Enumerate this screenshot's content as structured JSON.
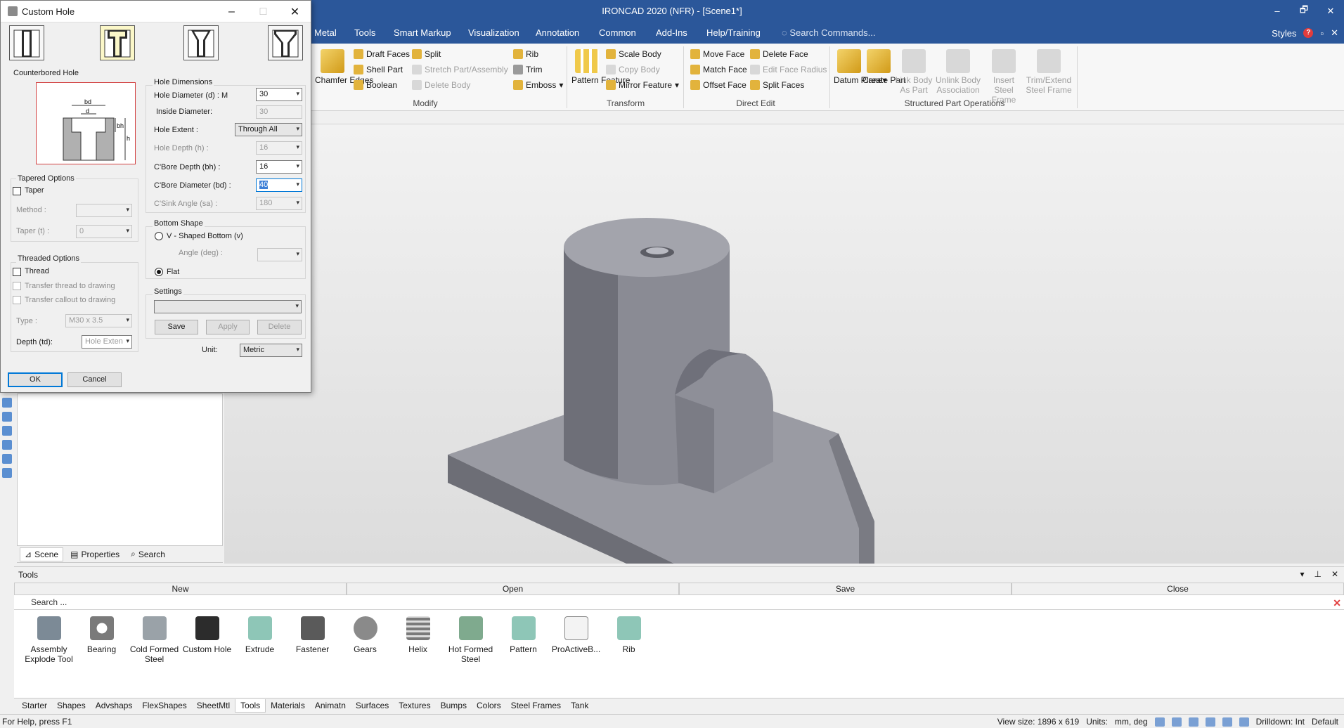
{
  "app": {
    "title": "IRONCAD 2020 (NFR) - [Scene1*]",
    "window_buttons": [
      "–",
      "🗗",
      "✕"
    ]
  },
  "ribbon": {
    "tabs": [
      "Metal",
      "Tools",
      "Smart Markup",
      "Visualization",
      "Annotation",
      "Common",
      "Add-Ins",
      "Help/Training"
    ],
    "search_placeholder": "Search Commands...",
    "styles_label": "Styles",
    "modify": {
      "group": "Modify",
      "chamfer": "Chamfer Edges",
      "draft_faces": "Draft Faces",
      "shell_part": "Shell Part",
      "boolean": "Boolean",
      "split": "Split",
      "stretch": "Stretch Part/Assembly",
      "delete_body": "Delete Body",
      "rib": "Rib",
      "trim": "Trim",
      "emboss": "Emboss"
    },
    "transform": {
      "group": "Transform",
      "pattern": "Pattern Feature",
      "scale_body": "Scale Body",
      "copy_body": "Copy Body",
      "mirror_feature": "Mirror Feature"
    },
    "direct_edit": {
      "group": "Direct Edit",
      "move_face": "Move Face",
      "match_face": "Match Face",
      "offset_face": "Offset Face",
      "delete_face": "Delete Face",
      "edit_face_radius": "Edit Face Radius",
      "split_faces": "Split Faces"
    },
    "structured": {
      "group": "Structured Part Operations",
      "datum_plane": "Datum Plane",
      "create_part": "Create Part",
      "link_body": "Link Body As Part",
      "unlink_body": "Unlink Body Association",
      "insert_steel": "Insert Steel Frame",
      "trim_extend": "Trim/Extend Steel Frame"
    }
  },
  "dialog": {
    "title": "Custom Hole",
    "selected_type": "Counterbored Hole",
    "preview_labels": {
      "bd": "bd",
      "d": "d",
      "bh": "bh",
      "h": "h"
    },
    "hole_dimensions": {
      "section": "Hole Dimensions",
      "diameter_label": "Hole Diameter (d) : M",
      "diameter_value": "30",
      "inside_label": "Inside Diameter:",
      "inside_value": "30",
      "extent_label": "Hole Extent :",
      "extent_value": "Through All",
      "depth_label": "Hole Depth (h) :",
      "depth_value": "16",
      "cbore_depth_label": "C'Bore Depth (bh) :",
      "cbore_depth_value": "16",
      "cbore_diam_label": "C'Bore Diameter (bd) :",
      "cbore_diam_value": "40",
      "csink_label": "C'Sink Angle (sa) :",
      "csink_value": "180"
    },
    "tapered": {
      "section": "Tapered Options",
      "taper_label": "Taper",
      "method_label": "Method :",
      "taper_t_label": "Taper (t) :",
      "taper_t_value": "0"
    },
    "threaded": {
      "section": "Threaded Options",
      "thread_label": "Thread",
      "transfer_thread": "Transfer thread to drawing",
      "transfer_callout": "Transfer callout to drawing",
      "type_label": "Type :",
      "type_value": "M30 x 3.5",
      "depth_label": "Depth (td):",
      "depth_value": "Hole Exten"
    },
    "bottom": {
      "section": "Bottom Shape",
      "v_shaped": "V - Shaped Bottom (v)",
      "angle_label": "Angle (deg) :",
      "flat": "Flat"
    },
    "settings": {
      "section": "Settings",
      "save": "Save",
      "apply": "Apply",
      "delete": "Delete"
    },
    "unit_label": "Unit:",
    "unit_value": "Metric",
    "ok": "OK",
    "cancel": "Cancel"
  },
  "scene_tabs": [
    "Scene",
    "Properties",
    "Search"
  ],
  "tools_panel": {
    "title": "Tools",
    "bar": [
      "New",
      "Open",
      "Save",
      "Close"
    ],
    "search": "Search ...",
    "items": [
      "Assembly Explode Tool",
      "Bearing",
      "Cold Formed Steel",
      "Custom Hole",
      "Extrude",
      "Fastener",
      "Gears",
      "Helix",
      "Hot Formed Steel",
      "Pattern",
      "ProActiveB...",
      "Rib"
    ],
    "categories": [
      "Starter",
      "Shapes",
      "Advshaps",
      "FlexShapes",
      "SheetMtl",
      "Tools",
      "Materials",
      "Animatn",
      "Surfaces",
      "Textures",
      "Bumps",
      "Colors",
      "Steel Frames",
      "Tank"
    ],
    "active_category": "Tools"
  },
  "status": {
    "help": "For Help, press F1",
    "view_size": "View size: 1896 x  619",
    "units": "Units:",
    "units_value": "mm, deg",
    "drilldown": "Drilldown: Int",
    "default": "Default"
  },
  "colors": {
    "title_blue": "#2b579a",
    "part_gray": "#8c8d96",
    "highlight": "#3d7fd6"
  }
}
